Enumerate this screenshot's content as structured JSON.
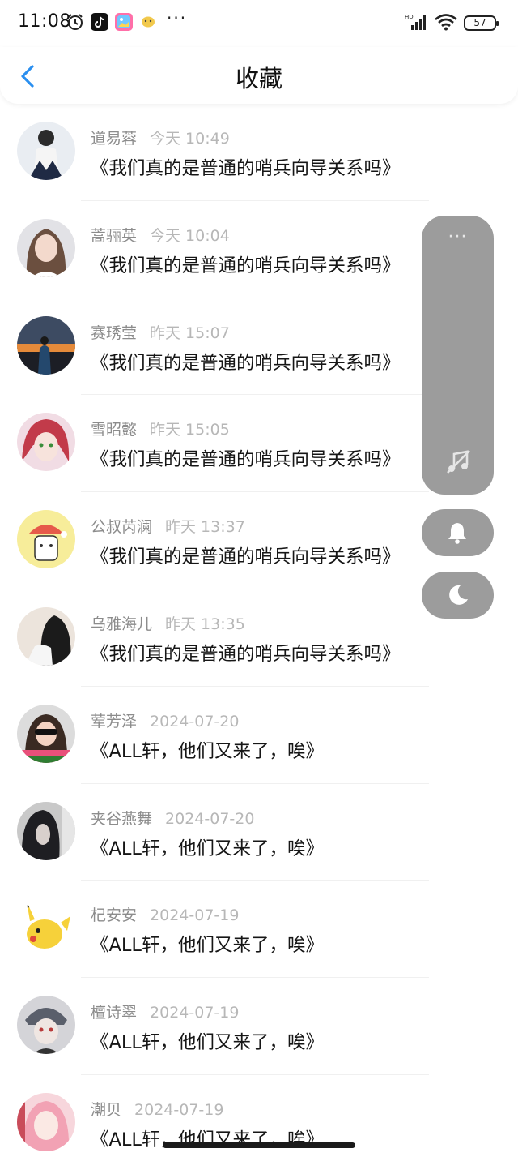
{
  "status_bar": {
    "time": "11:08",
    "dots": "···",
    "battery": "57"
  },
  "header": {
    "title": "收藏"
  },
  "items": [
    {
      "name": "道易蓉",
      "time": "今天 10:49",
      "title": "《我们真的是普通的哨兵向导关系吗》"
    },
    {
      "name": "蒿骊英",
      "time": "今天 10:04",
      "title": "《我们真的是普通的哨兵向导关系吗》"
    },
    {
      "name": "赛琇莹",
      "time": "昨天 15:07",
      "title": "《我们真的是普通的哨兵向导关系吗》"
    },
    {
      "name": "雪昭懿",
      "time": "昨天 15:05",
      "title": "《我们真的是普通的哨兵向导关系吗》"
    },
    {
      "name": "公叔芮澜",
      "time": "昨天 13:37",
      "title": "《我们真的是普通的哨兵向导关系吗》"
    },
    {
      "name": "乌雅海儿",
      "time": "昨天 13:35",
      "title": "《我们真的是普通的哨兵向导关系吗》"
    },
    {
      "name": "荤芳泽",
      "time": "2024-07-20",
      "title": "《ALL轩，他们又来了，唉》"
    },
    {
      "name": "夹谷燕舞",
      "time": "2024-07-20",
      "title": "《ALL轩，他们又来了，唉》"
    },
    {
      "name": "杞安安",
      "time": "2024-07-19",
      "title": "《ALL轩，他们又来了，唉》"
    },
    {
      "name": "檀诗翠",
      "time": "2024-07-19",
      "title": "《ALL轩，他们又来了，唉》"
    },
    {
      "name": "潮贝",
      "time": "2024-07-19",
      "title": "《ALL轩，他们又来了，唉》"
    }
  ],
  "float_panel": {
    "more": "···"
  },
  "colors": {
    "accent": "#2a8ff0",
    "float_bg": "#9c9c9c"
  }
}
